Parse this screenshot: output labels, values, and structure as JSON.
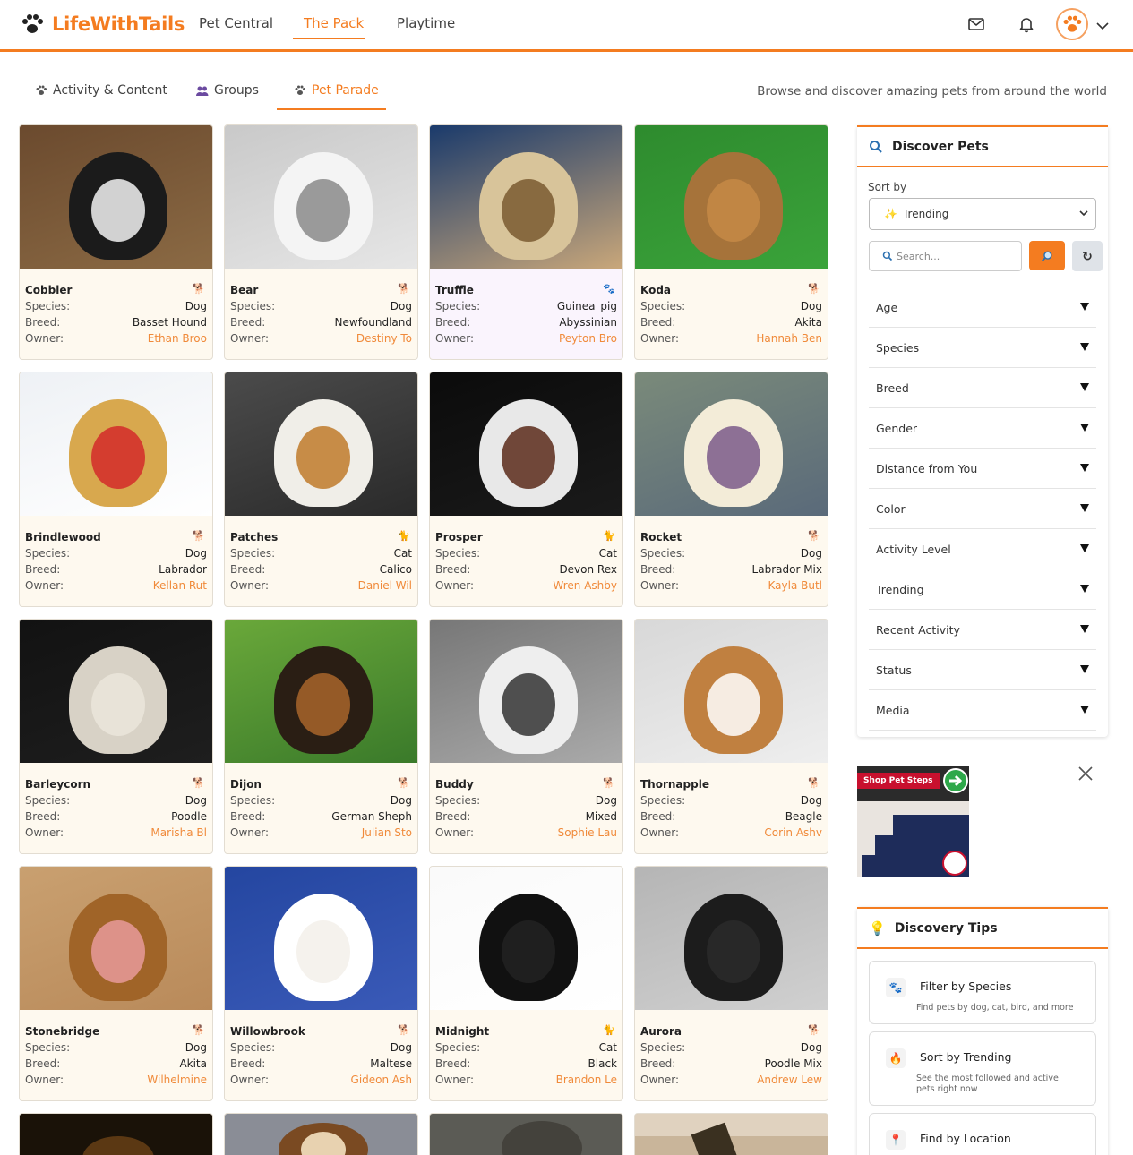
{
  "app": {
    "logo_text": "LifeWithTails",
    "nav_tabs": [
      {
        "label": "Pet Central"
      },
      {
        "label": "The Pack"
      },
      {
        "label": "Playtime"
      }
    ],
    "active_nav": "The Pack"
  },
  "subnav": {
    "tabs": [
      {
        "label": "Activity & Content"
      },
      {
        "label": "Groups"
      },
      {
        "label": "Pet Parade"
      }
    ],
    "active": "Pet Parade",
    "subtitle": "Browse and discover amazing pets from around the world"
  },
  "labels": {
    "species": "Species:",
    "breed": "Breed:",
    "owner": "Owner:"
  },
  "pets": [
    {
      "name": "Cobbler",
      "species": "Dog",
      "breed": "Basset Hound",
      "owner": "Ethan Broo",
      "icon": "dog-icon"
    },
    {
      "name": "Bear",
      "species": "Dog",
      "breed": "Newfoundland",
      "owner": "Destiny To",
      "icon": "dog-icon"
    },
    {
      "name": "Truffle",
      "species": "Guinea_pig",
      "breed": "Abyssinian",
      "owner": "Peyton Bro",
      "icon": "paw-icon"
    },
    {
      "name": "Koda",
      "species": "Dog",
      "breed": "Akita",
      "owner": "Hannah Ben",
      "icon": "dog-icon"
    },
    {
      "name": "Brindlewood",
      "species": "Dog",
      "breed": "Labrador",
      "owner": "Kellan Rut",
      "icon": "dog-icon"
    },
    {
      "name": "Patches",
      "species": "Cat",
      "breed": "Calico",
      "owner": "Daniel Wil",
      "icon": "cat-icon"
    },
    {
      "name": "Prosper",
      "species": "Cat",
      "breed": "Devon Rex",
      "owner": "Wren Ashby",
      "icon": "cat-icon"
    },
    {
      "name": "Rocket",
      "species": "Dog",
      "breed": "Labrador Mix",
      "owner": "Kayla Butl",
      "icon": "dog-icon"
    },
    {
      "name": "Barleycorn",
      "species": "Dog",
      "breed": "Poodle",
      "owner": "Marisha Bl",
      "icon": "dog-icon"
    },
    {
      "name": "Dijon",
      "species": "Dog",
      "breed": "German Sheph",
      "owner": "Julian Sto",
      "icon": "dog-icon"
    },
    {
      "name": "Buddy",
      "species": "Dog",
      "breed": "Mixed",
      "owner": "Sophie Lau",
      "icon": "dog-icon"
    },
    {
      "name": "Thornapple",
      "species": "Dog",
      "breed": "Beagle",
      "owner": "Corin Ashv",
      "icon": "dog-icon"
    },
    {
      "name": "Stonebridge",
      "species": "Dog",
      "breed": "Akita",
      "owner": "Wilhelmine",
      "icon": "dog-icon"
    },
    {
      "name": "Willowbrook",
      "species": "Dog",
      "breed": "Maltese",
      "owner": "Gideon Ash",
      "icon": "dog-icon"
    },
    {
      "name": "Midnight",
      "species": "Cat",
      "breed": "Black",
      "owner": "Brandon Le",
      "icon": "cat-icon"
    },
    {
      "name": "Aurora",
      "species": "Dog",
      "breed": "Poodle Mix",
      "owner": "Andrew Lew",
      "icon": "dog-icon"
    }
  ],
  "discover": {
    "title": "Discover Pets",
    "sort_label": "Sort by",
    "sort_value": "Trending",
    "search_placeholder": "Search...",
    "filters": [
      "Age",
      "Species",
      "Breed",
      "Gender",
      "Distance from You",
      "Color",
      "Activity Level",
      "Trending",
      "Recent Activity",
      "Status",
      "Media"
    ]
  },
  "ad": {
    "banner_text": "Shop Pet Steps"
  },
  "tips": {
    "title": "Discovery Tips",
    "items": [
      {
        "title": "Filter by Species",
        "desc": "Find pets by dog, cat, bird, and more"
      },
      {
        "title": "Sort by Trending",
        "desc": "See the most followed and active pets right now"
      },
      {
        "title": "Find by Location",
        "desc": ""
      }
    ]
  },
  "colors": {
    "accent": "#f47c20",
    "owner_link": "#f08a3a",
    "card_bg": "#fef9ef"
  }
}
